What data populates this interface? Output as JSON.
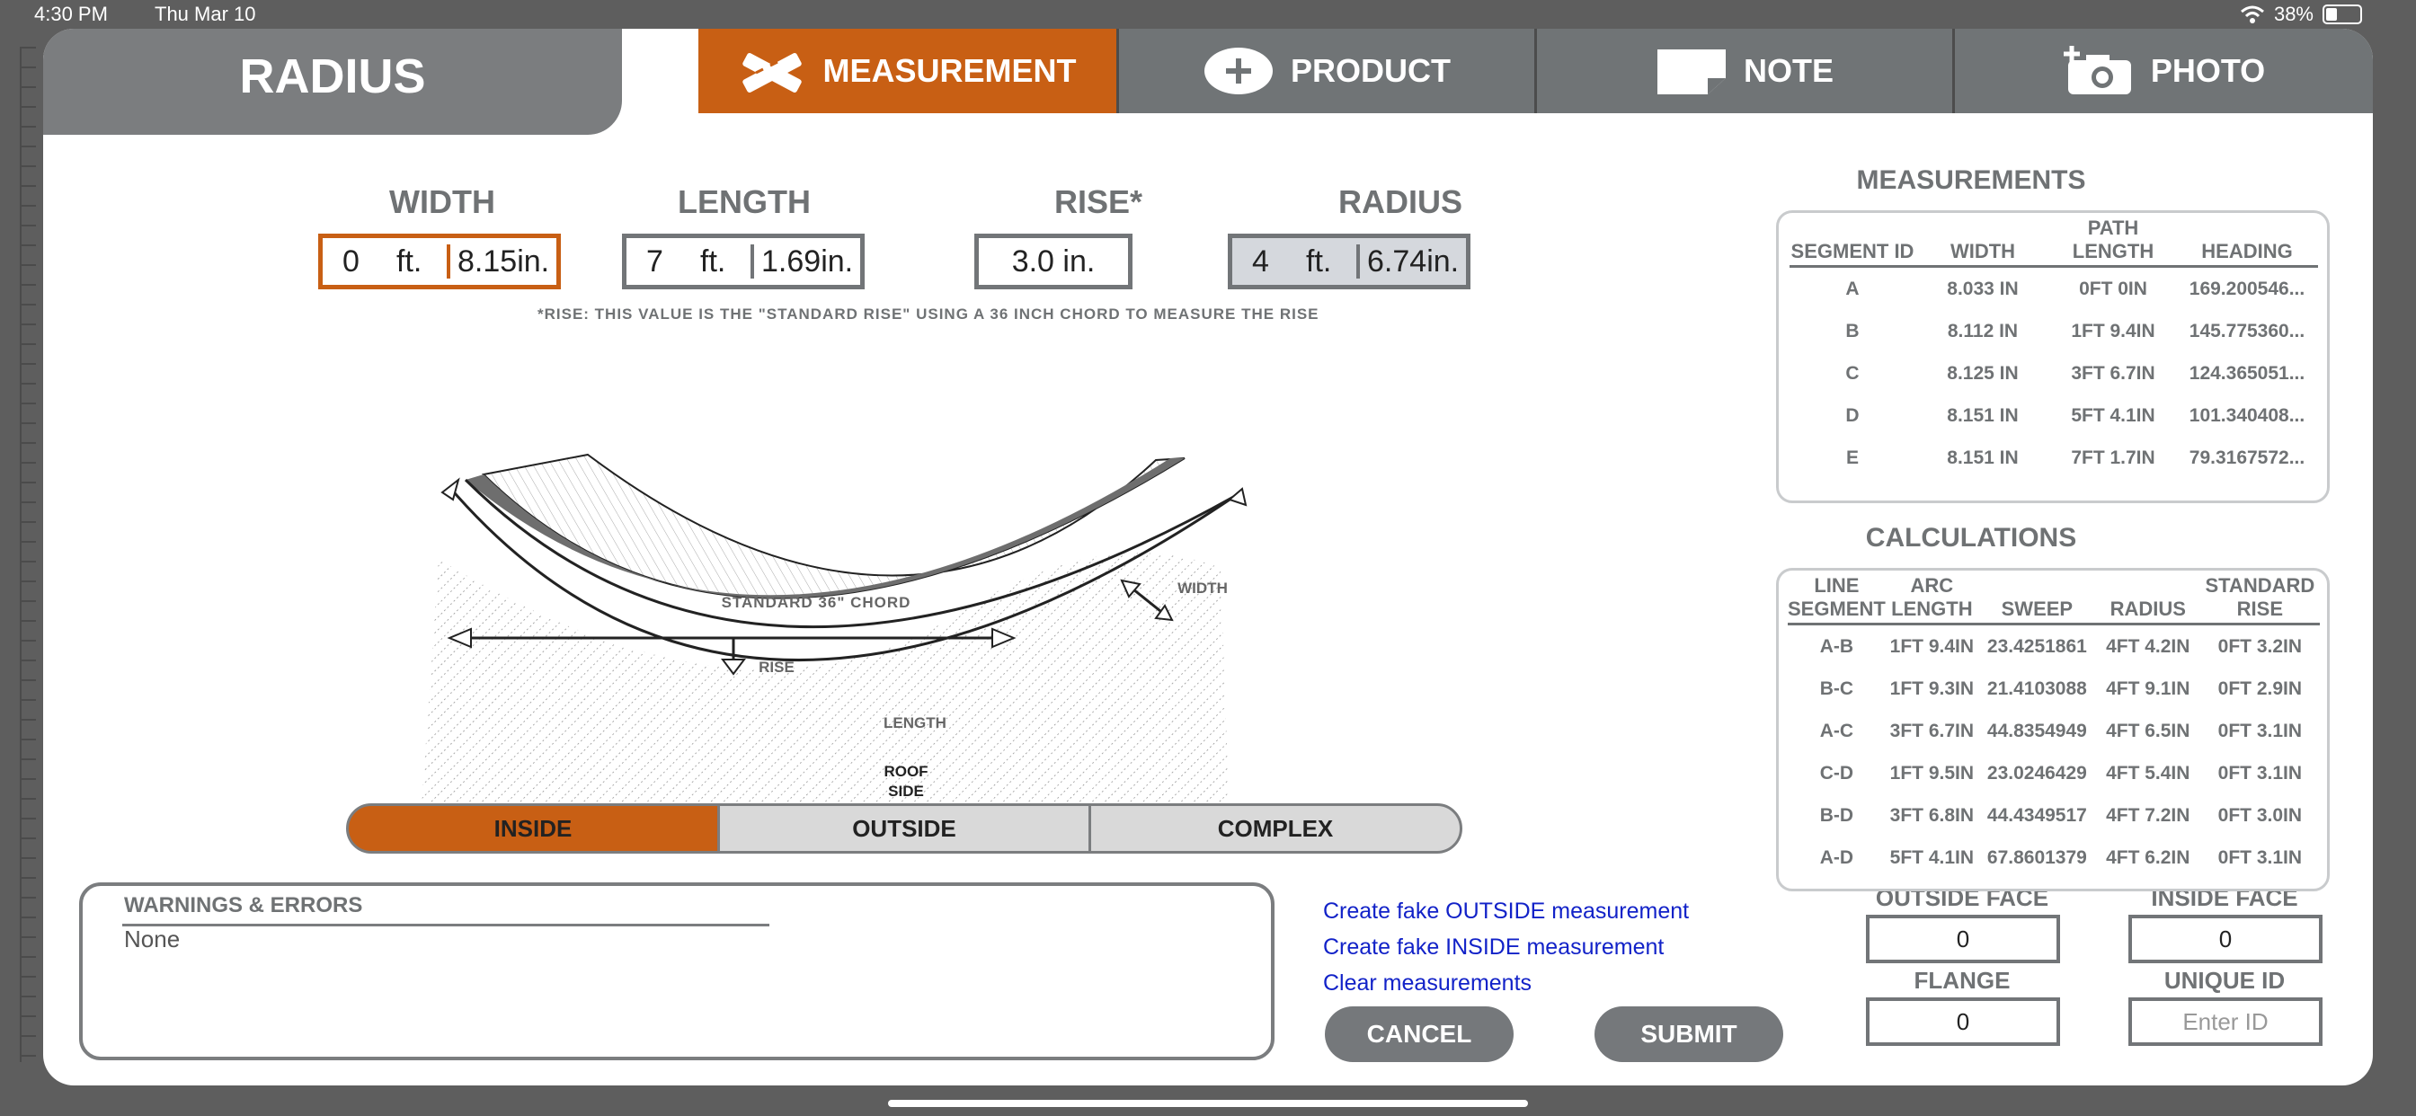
{
  "status": {
    "time": "4:30 PM",
    "date": "Thu Mar 10",
    "battery": "38%"
  },
  "app": {
    "title": "RADIUS"
  },
  "tabs": [
    {
      "label": "MEASUREMENT",
      "icon": "ruler-pencil-icon"
    },
    {
      "label": "PRODUCT",
      "icon": "plus-circle-icon"
    },
    {
      "label": "NOTE",
      "icon": "note-icon"
    },
    {
      "label": "PHOTO",
      "icon": "camera-plus-icon"
    }
  ],
  "inputs": {
    "width": {
      "label": "WIDTH",
      "ft": "0",
      "in": "8.15",
      "ft_unit": "ft.",
      "in_unit": "in."
    },
    "length": {
      "label": "LENGTH",
      "ft": "7",
      "in": "1.69",
      "ft_unit": "ft.",
      "in_unit": "in."
    },
    "rise": {
      "label": "RISE*",
      "value": "3.0 in."
    },
    "radius": {
      "label": "RADIUS",
      "ft": "4",
      "in": "6.74",
      "ft_unit": "ft.",
      "in_unit": "in."
    }
  },
  "rise_note": "*RISE: THIS VALUE IS THE \"STANDARD RISE\" USING A 36 INCH CHORD TO MEASURE THE RISE",
  "diagram": {
    "chord": "STANDARD 36\" CHORD",
    "width": "WIDTH",
    "rise": "RISE",
    "length": "LENGTH",
    "roof1": "ROOF",
    "roof2": "SIDE"
  },
  "mode": {
    "options": [
      "INSIDE",
      "OUTSIDE",
      "COMPLEX"
    ],
    "selected": "INSIDE"
  },
  "warnings": {
    "title": "WARNINGS & ERRORS",
    "value": "None"
  },
  "links": [
    "Create fake OUTSIDE measurement",
    "Create fake INSIDE measurement",
    "Clear measurements"
  ],
  "buttons": {
    "cancel": "CANCEL",
    "submit": "SUBMIT"
  },
  "small_fields": {
    "outside_face": {
      "label": "OUTSIDE FACE",
      "value": "0"
    },
    "inside_face": {
      "label": "INSIDE FACE",
      "value": "0"
    },
    "flange": {
      "label": "FLANGE",
      "value": "0"
    },
    "unique_id": {
      "label": "UNIQUE ID",
      "placeholder": "Enter ID"
    }
  },
  "measurements": {
    "title": "MEASUREMENTS",
    "headers": [
      "SEGMENT ID",
      "WIDTH",
      "PATH LENGTH",
      "HEADING"
    ],
    "rows": [
      [
        "A",
        "8.033 IN",
        "0FT 0IN",
        "169.200546..."
      ],
      [
        "B",
        "8.112 IN",
        "1FT 9.4IN",
        "145.775360..."
      ],
      [
        "C",
        "8.125 IN",
        "3FT 6.7IN",
        "124.365051..."
      ],
      [
        "D",
        "8.151 IN",
        "5FT 4.1IN",
        "101.340408..."
      ],
      [
        "E",
        "8.151 IN",
        "7FT 1.7IN",
        "79.3167572..."
      ]
    ]
  },
  "calculations": {
    "title": "CALCULATIONS",
    "headers": [
      "LINE SEGMENT",
      "ARC LENGTH",
      "SWEEP",
      "RADIUS",
      "STANDARD RISE"
    ],
    "rows": [
      [
        "A-B",
        "1FT 9.4IN",
        "23.4251861",
        "4FT 4.2IN",
        "0FT 3.2IN"
      ],
      [
        "B-C",
        "1FT 9.3IN",
        "21.4103088",
        "4FT 9.1IN",
        "0FT 2.9IN"
      ],
      [
        "A-C",
        "3FT 6.7IN",
        "44.8354949",
        "4FT 6.5IN",
        "0FT 3.1IN"
      ],
      [
        "C-D",
        "1FT 9.5IN",
        "23.0246429",
        "4FT 5.4IN",
        "0FT 3.1IN"
      ],
      [
        "B-D",
        "3FT 6.8IN",
        "44.4349517",
        "4FT 7.2IN",
        "0FT 3.0IN"
      ],
      [
        "A-D",
        "5FT 4.1IN",
        "67.8601379",
        "4FT 6.2IN",
        "0FT 3.1IN"
      ]
    ]
  },
  "colors": {
    "accent": "#c85f14",
    "tab_gray": "#707476",
    "link": "#1222c8"
  }
}
